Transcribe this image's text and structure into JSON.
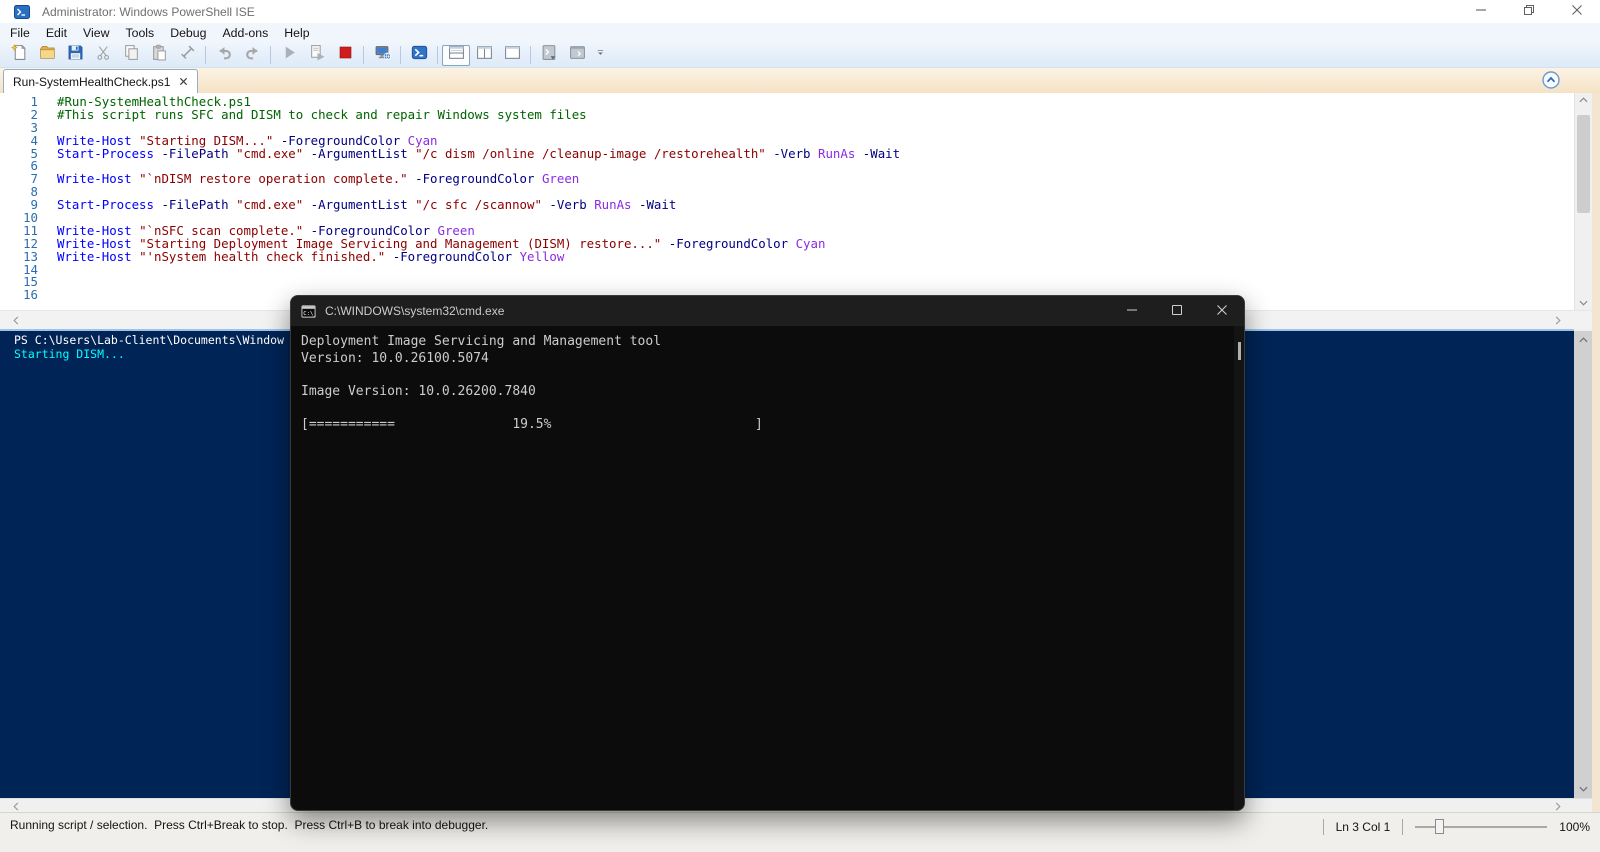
{
  "window": {
    "title": "Administrator: Windows PowerShell ISE",
    "controls": [
      "minimize",
      "restore",
      "close"
    ]
  },
  "menu": [
    "File",
    "Edit",
    "View",
    "Tools",
    "Debug",
    "Add-ons",
    "Help"
  ],
  "toolbar": {
    "groups": [
      [
        "new-script",
        "open-script",
        "save",
        "cut",
        "copy",
        "paste",
        "clear-console"
      ],
      [
        "undo",
        "redo"
      ],
      [
        "run-script",
        "run-selection",
        "stop-operation"
      ],
      [
        "new-remote-powershell-tab"
      ],
      [
        "start-powershell"
      ],
      [
        "script-pane-top",
        "script-pane-right",
        "script-pane-maximized"
      ],
      [
        "new-powershell-tab",
        "show-command-window"
      ]
    ],
    "overflow": "toolbar-overflow"
  },
  "tab": {
    "label": "Run-SystemHealthCheck.ps1",
    "close_glyph": "✕"
  },
  "editor": {
    "token_colors": {
      "cmdlet": "#0000FF",
      "param": "#000080",
      "string": "#8B0000",
      "arg": "#8A2BE2",
      "comment": "#006400",
      "plain": "#000000"
    },
    "lines": [
      {
        "n": 1,
        "seg": [
          [
            "comment",
            "#Run-SystemHealthCheck.ps1"
          ]
        ]
      },
      {
        "n": 2,
        "seg": [
          [
            "comment",
            "#This script runs SFC and DISM to check and repair Windows system files"
          ]
        ]
      },
      {
        "n": 3,
        "seg": []
      },
      {
        "n": 4,
        "seg": [
          [
            "cmdlet",
            "Write-Host"
          ],
          [
            "plain",
            " "
          ],
          [
            "string",
            "\"Starting DISM...\""
          ],
          [
            "plain",
            " "
          ],
          [
            "param",
            "-ForegroundColor"
          ],
          [
            "plain",
            " "
          ],
          [
            "arg",
            "Cyan"
          ]
        ]
      },
      {
        "n": 5,
        "seg": [
          [
            "cmdlet",
            "Start-Process"
          ],
          [
            "plain",
            " "
          ],
          [
            "param",
            "-FilePath"
          ],
          [
            "plain",
            " "
          ],
          [
            "string",
            "\"cmd.exe\""
          ],
          [
            "plain",
            " "
          ],
          [
            "param",
            "-ArgumentList"
          ],
          [
            "plain",
            " "
          ],
          [
            "string",
            "\"/c dism /online /cleanup-image /restorehealth\""
          ],
          [
            "plain",
            " "
          ],
          [
            "param",
            "-Verb"
          ],
          [
            "plain",
            " "
          ],
          [
            "arg",
            "RunAs"
          ],
          [
            "plain",
            " "
          ],
          [
            "param",
            "-Wait"
          ]
        ]
      },
      {
        "n": 6,
        "seg": []
      },
      {
        "n": 7,
        "seg": [
          [
            "cmdlet",
            "Write-Host"
          ],
          [
            "plain",
            " "
          ],
          [
            "string",
            "\"`nDISM restore operation complete.\""
          ],
          [
            "plain",
            " "
          ],
          [
            "param",
            "-ForegroundColor"
          ],
          [
            "plain",
            " "
          ],
          [
            "arg",
            "Green"
          ]
        ]
      },
      {
        "n": 8,
        "seg": []
      },
      {
        "n": 9,
        "seg": [
          [
            "cmdlet",
            "Start-Process"
          ],
          [
            "plain",
            " "
          ],
          [
            "param",
            "-FilePath"
          ],
          [
            "plain",
            " "
          ],
          [
            "string",
            "\"cmd.exe\""
          ],
          [
            "plain",
            " "
          ],
          [
            "param",
            "-ArgumentList"
          ],
          [
            "plain",
            " "
          ],
          [
            "string",
            "\"/c sfc /scannow\""
          ],
          [
            "plain",
            " "
          ],
          [
            "param",
            "-Verb"
          ],
          [
            "plain",
            " "
          ],
          [
            "arg",
            "RunAs"
          ],
          [
            "plain",
            " "
          ],
          [
            "param",
            "-Wait"
          ]
        ]
      },
      {
        "n": 10,
        "seg": []
      },
      {
        "n": 11,
        "seg": [
          [
            "cmdlet",
            "Write-Host"
          ],
          [
            "plain",
            " "
          ],
          [
            "string",
            "\"`nSFC scan complete.\""
          ],
          [
            "plain",
            " "
          ],
          [
            "param",
            "-ForegroundColor"
          ],
          [
            "plain",
            " "
          ],
          [
            "arg",
            "Green"
          ]
        ]
      },
      {
        "n": 12,
        "seg": [
          [
            "cmdlet",
            "Write-Host"
          ],
          [
            "plain",
            " "
          ],
          [
            "string",
            "\"Starting Deployment Image Servicing and Management (DISM) restore...\""
          ],
          [
            "plain",
            " "
          ],
          [
            "param",
            "-ForegroundColor"
          ],
          [
            "plain",
            " "
          ],
          [
            "arg",
            "Cyan"
          ]
        ]
      },
      {
        "n": 13,
        "seg": [
          [
            "cmdlet",
            "Write-Host"
          ],
          [
            "plain",
            " "
          ],
          [
            "string",
            "\"'nSystem health check finished.\""
          ],
          [
            "plain",
            " "
          ],
          [
            "param",
            "-ForegroundColor"
          ],
          [
            "plain",
            " "
          ],
          [
            "arg",
            "Yellow"
          ]
        ]
      },
      {
        "n": 14,
        "seg": []
      },
      {
        "n": 15,
        "seg": []
      },
      {
        "n": 16,
        "seg": []
      }
    ]
  },
  "console": {
    "background": "#012456",
    "lines": [
      {
        "text": "PS C:\\Users\\Lab-Client\\Documents\\Window",
        "color": "#FFFFFF"
      },
      {
        "text": "Starting DISM...",
        "color": "#00FFFF"
      }
    ]
  },
  "cmd_window": {
    "title": "C:\\WINDOWS\\system32\\cmd.exe",
    "controls": [
      "minimize",
      "maximize",
      "close"
    ],
    "lines": [
      "Deployment Image Servicing and Management tool",
      "Version: 10.0.26100.5074",
      "",
      "Image Version: 10.0.26200.7840",
      "",
      "[===========               19.5%                          ]"
    ],
    "progress_percent": "19.5%"
  },
  "status_bar": {
    "message": "Running script / selection.  Press Ctrl+Break to stop.  Press Ctrl+B to break into debugger.",
    "position": "Ln 3 Col 1",
    "zoom_level": "100%"
  }
}
